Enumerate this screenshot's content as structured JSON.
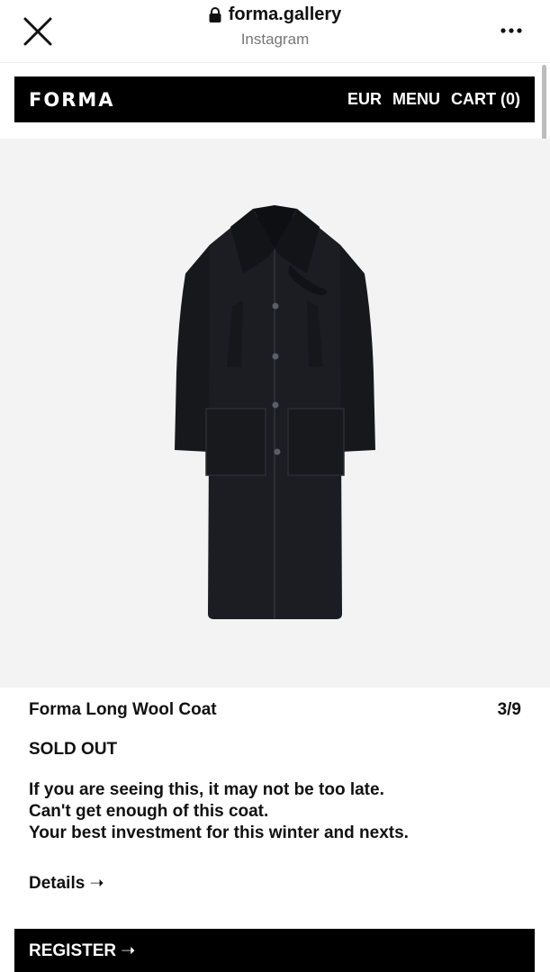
{
  "browser": {
    "domain": "forma.gallery",
    "subtitle": "Instagram",
    "close_icon": "close-icon",
    "lock_icon": "lock-icon",
    "more_icon": "more-icon"
  },
  "header": {
    "logo": "FORMA",
    "nav": {
      "currency": "EUR",
      "menu": "MENU",
      "cart": "CART (0)"
    }
  },
  "product": {
    "image_alt": "black wool coat",
    "title": "Forma Long Wool Coat",
    "image_counter": "3/9",
    "status": "SOLD OUT",
    "description": [
      "If you are seeing this, it may not be too late.",
      "Can't get enough of this coat.",
      "Your best investment for this winter and nexts."
    ],
    "details_link": "Details ➝"
  },
  "register": {
    "label": "REGISTER ➝"
  },
  "colors": {
    "header_bg": "#000000",
    "image_bg": "#f3f3f3",
    "text": "#111111",
    "subtle": "#777777"
  }
}
